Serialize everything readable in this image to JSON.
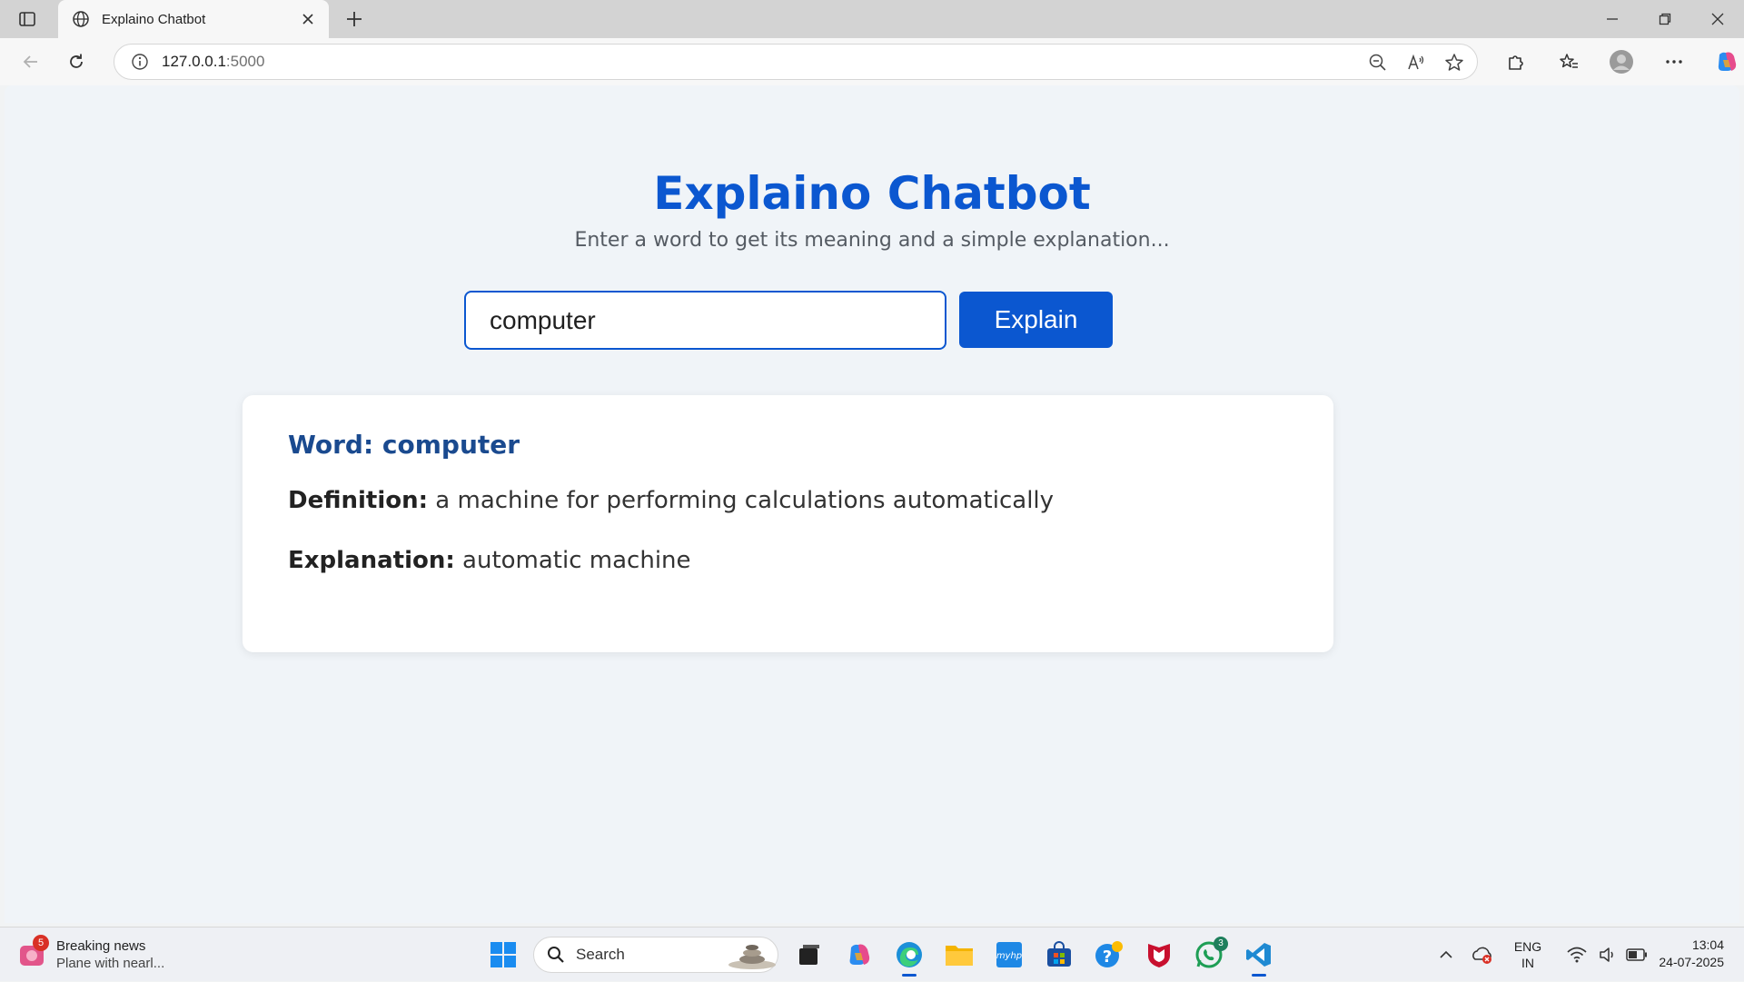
{
  "browser": {
    "tab_title": "Explaino Chatbot",
    "url_host": "127.0.0.1",
    "url_port": ":5000"
  },
  "page": {
    "title": "Explaino Chatbot",
    "subtitle": "Enter a word to get its meaning and a simple explanation...",
    "input_value": "computer",
    "button_label": "Explain",
    "result": {
      "word_label": "Word: computer",
      "definition_label": "Definition:",
      "definition_text": " a machine for performing calculations automatically",
      "explanation_label": "Explanation:",
      "explanation_text": " automatic machine"
    },
    "colors": {
      "accent": "#0b57d0",
      "background": "#f0f4f8",
      "card": "#ffffff"
    }
  },
  "taskbar": {
    "news_badge": "5",
    "news_title": "Breaking news",
    "news_sub": "Plane with nearl...",
    "search_label": "Search",
    "whatsapp_badge": "3",
    "lang_line1": "ENG",
    "lang_line2": "IN",
    "time": "13:04",
    "date": "24-07-2025"
  }
}
